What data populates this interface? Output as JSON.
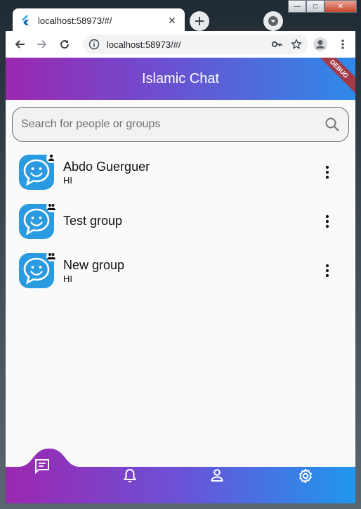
{
  "browser": {
    "tab_title": "localhost:58973/#/",
    "url": "localhost:58973/#/"
  },
  "app": {
    "title": "Islamic Chat",
    "debug_label": "DEBUG",
    "search_placeholder": "Search for people or groups",
    "chats": [
      {
        "name": "Abdo Guerguer",
        "subtitle": "HI",
        "type": "person-icon"
      },
      {
        "name": "Test group",
        "subtitle": "",
        "type": "group-icon"
      },
      {
        "name": "New group",
        "subtitle": "HI",
        "type": "group-icon"
      }
    ],
    "nav": [
      "chat-icon",
      "bell-icon",
      "person-icon",
      "settings-icon"
    ],
    "colors": {
      "gradient_start": "#9c27b0",
      "gradient_end": "#2f8ae8",
      "avatar_blue": "#2a9be0"
    }
  }
}
